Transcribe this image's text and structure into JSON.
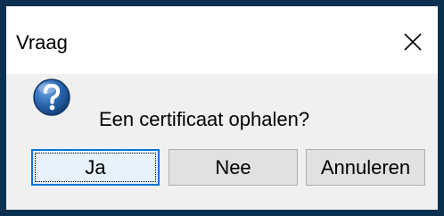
{
  "window": {
    "title": "Vraag",
    "close_icon": "close-icon"
  },
  "content": {
    "icon": "question-icon",
    "message": "Een certificaat ophalen?"
  },
  "buttons": {
    "yes": "Ja",
    "no": "Nee",
    "cancel": "Annuleren"
  },
  "colors": {
    "frame": "#0c3050",
    "accent": "#0078d7",
    "panel": "#f0f0f0",
    "icon_blue": "#2a66b0"
  }
}
